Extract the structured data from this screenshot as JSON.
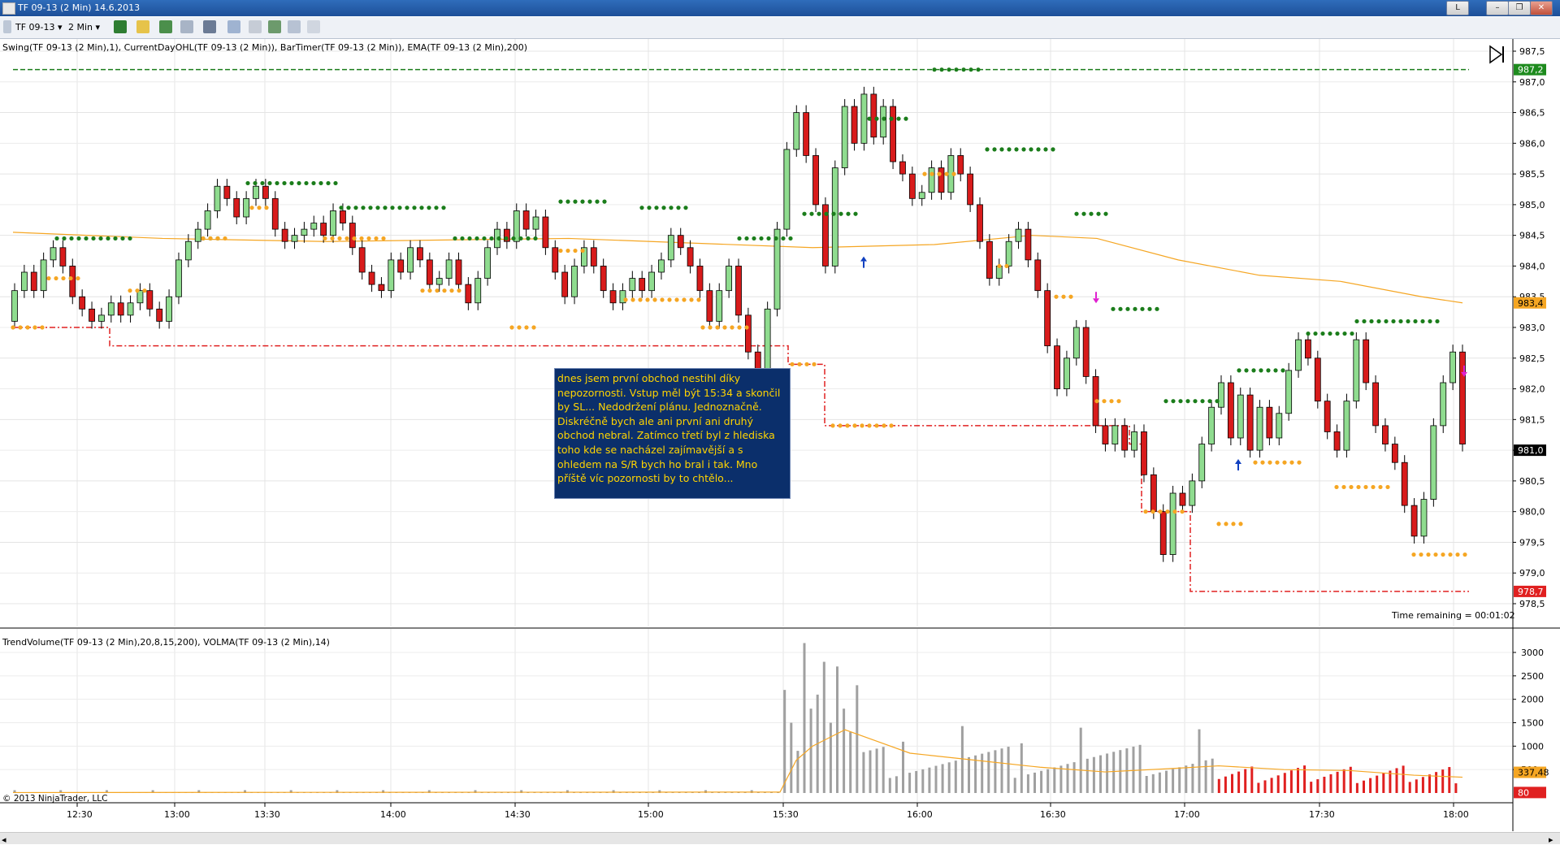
{
  "window": {
    "title": "TF 09-13 (2 Min)  14.6.2013",
    "buttons": [
      "L",
      "–",
      "❐",
      "✕"
    ]
  },
  "toolbar": {
    "instrument": "TF 09-13",
    "interval": "2 Min"
  },
  "price_pane": {
    "indicator_label": "Swing(TF 09-13 (2 Min),1), CurrentDayOHL(TF 09-13 (2 Min)), BarTimer(TF 09-13 (2 Min)), EMA(TF 09-13 (2 Min),200)",
    "time_remaining": "Time remaining = 00:01:02",
    "price_ticks": [
      "987,5",
      "987,0",
      "986,5",
      "986,0",
      "985,5",
      "985,0",
      "984,5",
      "984,0",
      "983,5",
      "983,0",
      "982,5",
      "982,0",
      "981,5",
      "981,0",
      "980,5",
      "980,0",
      "979,5",
      "979,0",
      "978,5"
    ],
    "markers": [
      {
        "label": "987,2",
        "color": "#1e8b1e"
      },
      {
        "label": "983,4",
        "color": "#f5a623"
      },
      {
        "label": "981,0",
        "color": "#000000"
      },
      {
        "label": "978,7",
        "color": "#e02020"
      }
    ]
  },
  "volume_pane": {
    "indicator_label": "TrendVolume(TF 09-13 (2 Min),20,8,15,200), VOLMA(TF 09-13 (2 Min),14)",
    "ticks": [
      "3000",
      "2500",
      "2000",
      "1500",
      "1000",
      "500"
    ],
    "markers": [
      {
        "label": "337,48",
        "color": "#f5a623"
      },
      {
        "label": "80",
        "color": "#e02020"
      }
    ]
  },
  "copyright": "© 2013 NinjaTrader, LLC",
  "time_axis": [
    "12:30",
    "13:00",
    "13:30",
    "14:00",
    "14:30",
    "15:00",
    "15:30",
    "16:00",
    "16:30",
    "17:00",
    "17:30",
    "18:00"
  ],
  "note_text": "dnes jsem první obchod nestihl díky nepozornosti. Vstup měl být 15:34 a skončil by SL... Nedodržení plánu. Jednoznačně. Diskréčně bych ale ani první ani druhý obchod nebral. Zatímco třetí byl z hlediska toho kde se nacházel zajímavější a s ohledem na S/R bych ho bral i tak. Mno příště víc pozornosti by to chtělo...",
  "chart_data": {
    "type": "candlestick",
    "y_range": [
      978.5,
      987.5
    ],
    "current_day_high": 987.2,
    "current_day_low": 978.7,
    "last_price": 981.0,
    "ema_200_last": 983.4,
    "volume_last": 80,
    "volma_last": 337.48,
    "volume_range": [
      0,
      3000
    ]
  }
}
